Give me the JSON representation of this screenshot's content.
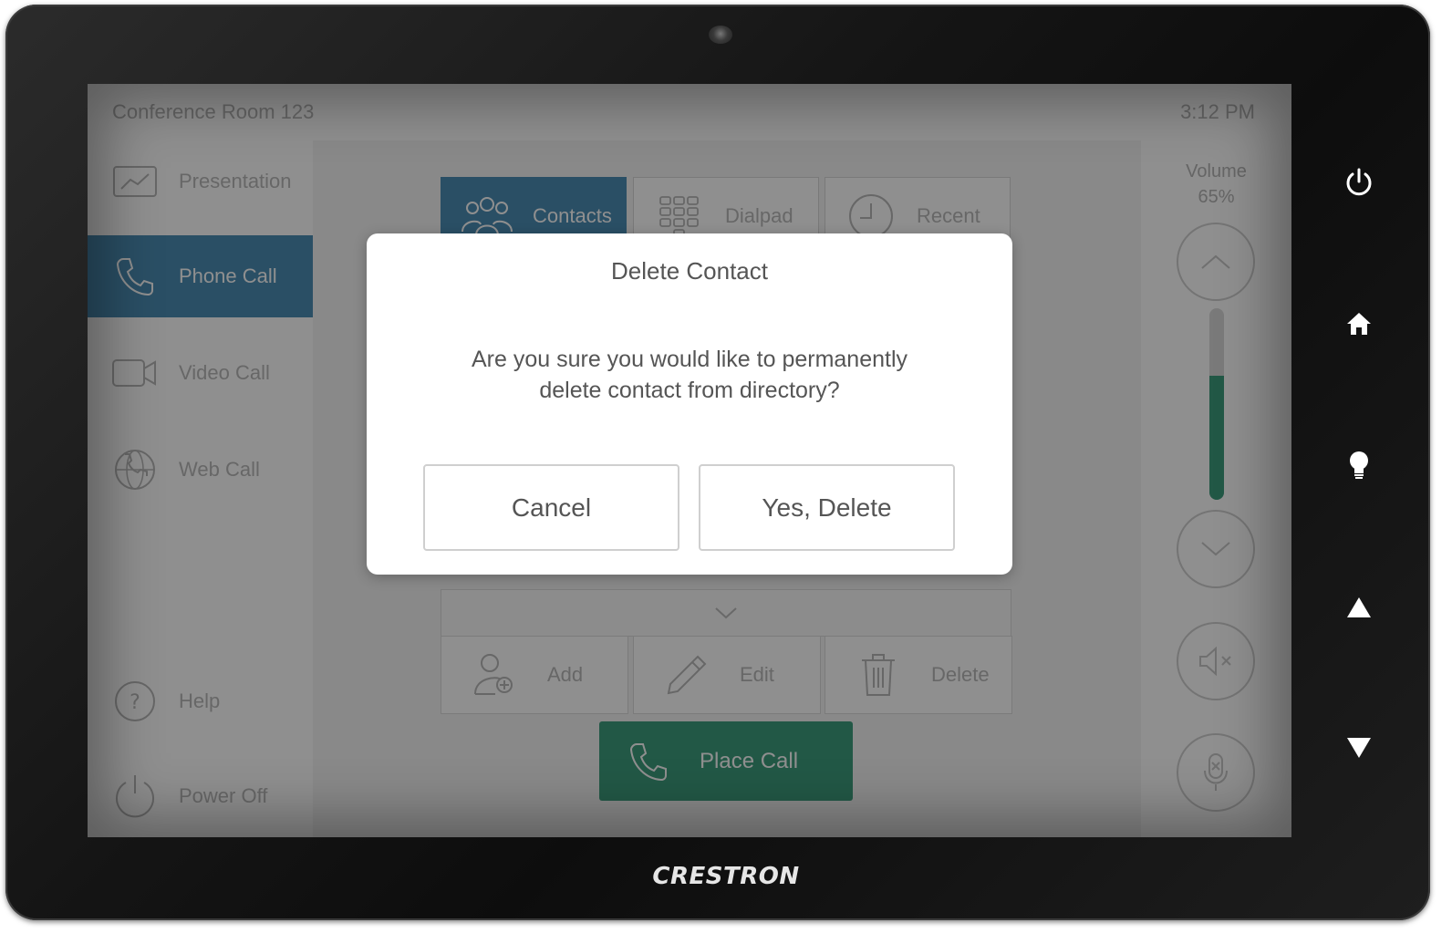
{
  "device": {
    "brand": "CRESTRON"
  },
  "header": {
    "room_name": "Conference Room 123",
    "time": "3:12 PM"
  },
  "sidebar": {
    "items": [
      {
        "label": "Presentation",
        "icon": "presentation-chart-icon"
      },
      {
        "label": "Phone Call",
        "icon": "phone-icon",
        "active": true
      },
      {
        "label": "Video Call",
        "icon": "video-camera-icon"
      },
      {
        "label": "Web Call",
        "icon": "web-phone-icon"
      },
      {
        "label": "Help",
        "icon": "help-icon"
      },
      {
        "label": "Power Off",
        "icon": "power-icon"
      }
    ]
  },
  "tabs": [
    {
      "label": "Contacts",
      "icon": "contacts-group-icon",
      "active": true
    },
    {
      "label": "Dialpad",
      "icon": "dialpad-icon"
    },
    {
      "label": "Recent",
      "icon": "clock-icon"
    }
  ],
  "actions": [
    {
      "label": "Add",
      "icon": "add-contact-icon"
    },
    {
      "label": "Edit",
      "icon": "pencil-icon"
    },
    {
      "label": "Delete",
      "icon": "trash-icon"
    }
  ],
  "place_call": {
    "label": "Place Call",
    "icon": "phone-icon"
  },
  "volume": {
    "label": "Volume",
    "percent_text": "65%",
    "level": 0.65
  },
  "dialog": {
    "title": "Delete Contact",
    "message": "Are you sure you would like to permanently delete contact from directory?",
    "cancel_label": "Cancel",
    "confirm_label": "Yes, Delete"
  },
  "colors": {
    "accent_blue": "#4b8db5",
    "accent_green": "#3e9d7e"
  }
}
